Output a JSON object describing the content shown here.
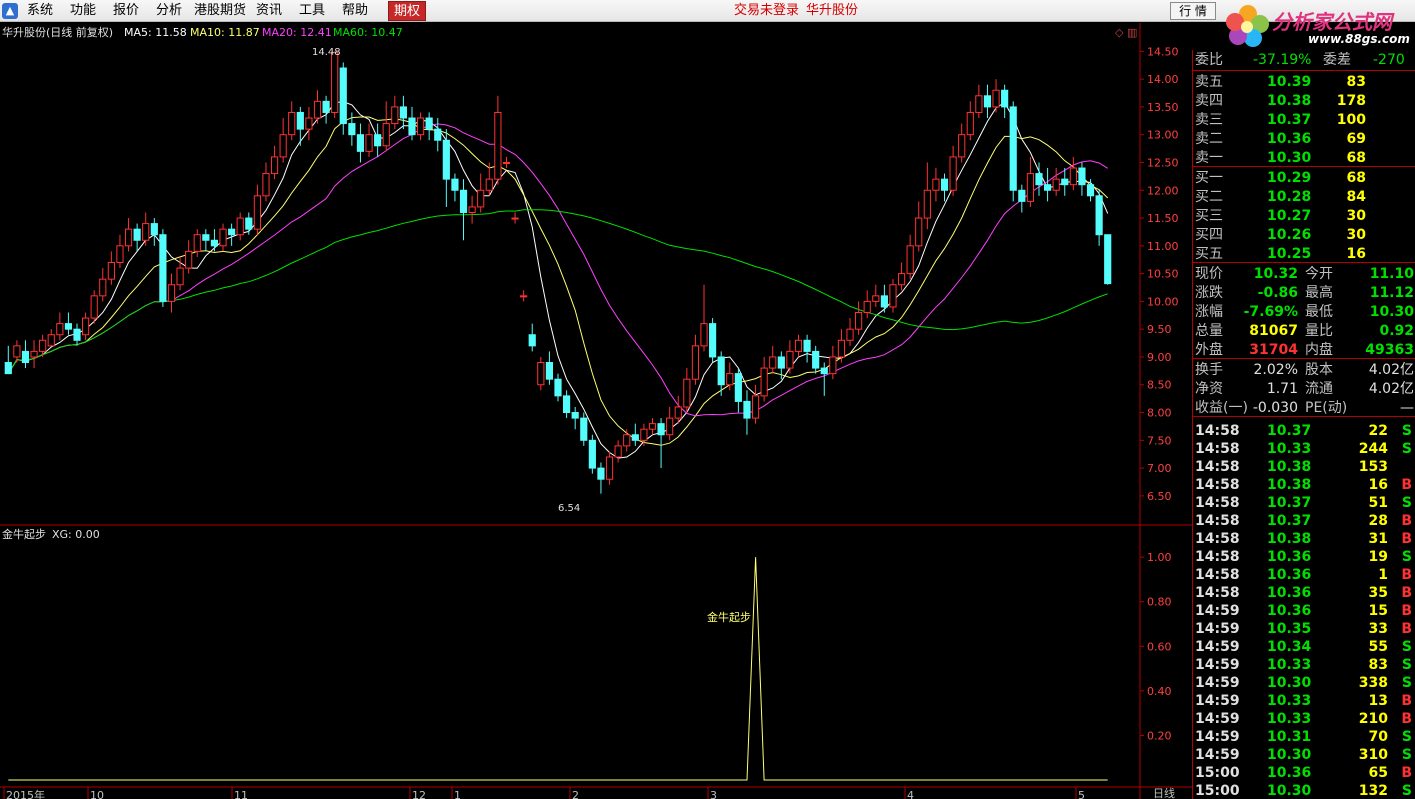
{
  "menu": {
    "items": [
      "系统",
      "功能",
      "报价",
      "分析",
      "港股期货",
      "资讯",
      "工具",
      "帮助"
    ],
    "active": "期权",
    "status1": "交易未登录",
    "status2": "华升股份",
    "quote_button": "行 情"
  },
  "brand": {
    "title": "分析家公式网",
    "url": "www.88gs.com"
  },
  "main_chart": {
    "title": "华升股份(日线 前复权)",
    "ma5_label": "MA5: 11.58",
    "ma10_label": "MA10: 11.87",
    "ma20_label": "MA20: 12.41",
    "ma60_label": "MA60: 10.47",
    "high_label": "14.48",
    "low_label": "6.54",
    "y_ticks": [
      "14.50",
      "14.00",
      "13.50",
      "13.00",
      "12.50",
      "12.00",
      "11.50",
      "11.00",
      "10.50",
      "10.00",
      "9.50",
      "9.00",
      "8.50",
      "8.00",
      "7.50",
      "7.00",
      "6.50"
    ],
    "colors": {
      "up": "#ff3232",
      "down": "#54fcfc",
      "ma5": "#ffffff",
      "ma10": "#ffff70",
      "ma20": "#ff40ff",
      "ma60": "#00e000",
      "axis": "#b00000"
    }
  },
  "sub_chart": {
    "title": "金牛起步",
    "xg_label": "XG: 0.00",
    "signal_label": "金牛起步",
    "y_ticks": [
      "1.00",
      "0.80",
      "0.60",
      "0.40",
      "0.20"
    ]
  },
  "x_axis": {
    "labels": [
      "2015年",
      "10",
      "11",
      "12",
      "1",
      "2",
      "3",
      "4",
      "5"
    ],
    "period": "日线"
  },
  "chart_data": {
    "type": "candlestick",
    "title": "华升股份(日线 前复权)",
    "ylim": [
      6.3,
      14.65
    ],
    "high": 14.48,
    "low": 6.54,
    "candles_ohlc": [
      [
        8.9,
        8.7,
        9.2,
        8.7
      ],
      [
        9.0,
        9.2,
        9.3,
        8.9
      ],
      [
        9.1,
        8.9,
        9.3,
        8.8
      ],
      [
        9.0,
        9.1,
        9.3,
        8.8
      ],
      [
        9.1,
        9.3,
        9.4,
        9.0
      ],
      [
        9.2,
        9.4,
        9.5,
        9.2
      ],
      [
        9.4,
        9.6,
        9.8,
        9.3
      ],
      [
        9.6,
        9.5,
        9.8,
        9.4
      ],
      [
        9.5,
        9.3,
        9.6,
        9.2
      ],
      [
        9.4,
        9.7,
        9.8,
        9.3
      ],
      [
        9.7,
        10.1,
        10.2,
        9.6
      ],
      [
        10.1,
        10.4,
        10.6,
        10.0
      ],
      [
        10.4,
        10.7,
        10.9,
        10.3
      ],
      [
        10.7,
        11.0,
        11.2,
        10.6
      ],
      [
        11.0,
        11.3,
        11.5,
        10.9
      ],
      [
        11.3,
        11.1,
        11.4,
        10.9
      ],
      [
        11.1,
        11.4,
        11.6,
        11.0
      ],
      [
        11.4,
        11.2,
        11.5,
        11.0
      ],
      [
        11.2,
        10.0,
        11.3,
        9.9
      ],
      [
        10.0,
        10.3,
        10.5,
        9.8
      ],
      [
        10.3,
        10.6,
        10.8,
        10.2
      ],
      [
        10.6,
        10.9,
        11.1,
        10.5
      ],
      [
        10.9,
        11.2,
        11.3,
        10.8
      ],
      [
        11.2,
        11.1,
        11.3,
        10.9
      ],
      [
        11.1,
        11.0,
        11.3,
        10.9
      ],
      [
        11.0,
        11.3,
        11.4,
        10.9
      ],
      [
        11.3,
        11.2,
        11.4,
        11.0
      ],
      [
        11.2,
        11.5,
        11.6,
        11.1
      ],
      [
        11.5,
        11.3,
        11.6,
        11.2
      ],
      [
        11.3,
        11.9,
        12.1,
        11.2
      ],
      [
        11.9,
        12.3,
        12.5,
        11.8
      ],
      [
        12.3,
        12.6,
        12.8,
        12.2
      ],
      [
        12.6,
        13.0,
        13.3,
        12.5
      ],
      [
        13.0,
        13.4,
        13.6,
        12.9
      ],
      [
        13.4,
        13.1,
        13.5,
        12.8
      ],
      [
        13.1,
        13.3,
        13.5,
        12.9
      ],
      [
        13.3,
        13.6,
        13.8,
        13.2
      ],
      [
        13.6,
        13.4,
        13.7,
        13.2
      ],
      [
        13.4,
        14.48,
        14.5,
        13.3
      ],
      [
        14.2,
        13.2,
        14.3,
        13.0
      ],
      [
        13.2,
        13.0,
        13.4,
        12.8
      ],
      [
        13.0,
        12.7,
        13.2,
        12.5
      ],
      [
        12.7,
        13.0,
        13.2,
        12.6
      ],
      [
        13.0,
        12.8,
        13.2,
        12.6
      ],
      [
        12.8,
        13.2,
        13.6,
        12.7
      ],
      [
        13.2,
        13.5,
        13.7,
        13.1
      ],
      [
        13.5,
        13.3,
        13.7,
        13.1
      ],
      [
        13.3,
        13.0,
        13.5,
        12.9
      ],
      [
        13.0,
        13.3,
        13.4,
        12.9
      ],
      [
        13.3,
        13.1,
        13.4,
        12.9
      ],
      [
        13.1,
        12.9,
        13.3,
        12.7
      ],
      [
        12.9,
        12.2,
        13.1,
        11.7
      ],
      [
        12.2,
        12.0,
        12.3,
        11.8
      ],
      [
        12.0,
        11.6,
        12.2,
        11.1
      ],
      [
        11.6,
        11.7,
        11.9,
        11.4
      ],
      [
        11.7,
        12.0,
        12.3,
        11.6
      ],
      [
        12.0,
        12.2,
        12.5,
        11.9
      ],
      [
        12.2,
        13.4,
        13.7,
        12.1
      ],
      [
        12.5,
        12.5,
        12.6,
        12.4
      ],
      [
        11.5,
        11.5,
        11.6,
        11.4
      ],
      [
        10.1,
        10.1,
        10.2,
        10.0
      ],
      [
        9.4,
        9.2,
        9.6,
        9.1
      ],
      [
        8.5,
        8.9,
        9.0,
        8.4
      ],
      [
        8.9,
        8.6,
        9.1,
        8.5
      ],
      [
        8.6,
        8.3,
        8.7,
        8.2
      ],
      [
        8.3,
        8.0,
        8.4,
        7.9
      ],
      [
        8.0,
        7.9,
        8.1,
        7.7
      ],
      [
        7.9,
        7.5,
        8.0,
        7.4
      ],
      [
        7.5,
        7.0,
        7.6,
        6.9
      ],
      [
        7.0,
        6.8,
        7.1,
        6.54
      ],
      [
        6.8,
        7.2,
        7.3,
        6.7
      ],
      [
        7.2,
        7.4,
        7.5,
        7.1
      ],
      [
        7.4,
        7.6,
        7.7,
        7.3
      ],
      [
        7.6,
        7.5,
        7.8,
        7.4
      ],
      [
        7.5,
        7.7,
        7.8,
        7.4
      ],
      [
        7.7,
        7.8,
        7.9,
        7.6
      ],
      [
        7.8,
        7.6,
        7.9,
        7.0
      ],
      [
        7.6,
        7.9,
        8.1,
        7.5
      ],
      [
        7.9,
        8.1,
        8.3,
        7.8
      ],
      [
        8.1,
        8.6,
        8.8,
        8.0
      ],
      [
        8.6,
        9.2,
        9.4,
        8.5
      ],
      [
        9.2,
        9.6,
        10.3,
        9.1
      ],
      [
        9.6,
        9.0,
        9.7,
        8.9
      ],
      [
        9.0,
        8.5,
        9.1,
        8.3
      ],
      [
        8.5,
        8.7,
        8.9,
        8.4
      ],
      [
        8.7,
        8.2,
        8.8,
        8.0
      ],
      [
        8.2,
        7.9,
        8.4,
        7.6
      ],
      [
        7.9,
        8.3,
        8.5,
        7.8
      ],
      [
        8.3,
        8.8,
        9.0,
        8.2
      ],
      [
        8.8,
        9.0,
        9.2,
        8.7
      ],
      [
        9.0,
        8.8,
        9.1,
        8.6
      ],
      [
        8.8,
        9.1,
        9.3,
        8.7
      ],
      [
        9.1,
        9.3,
        9.4,
        9.0
      ],
      [
        9.3,
        9.1,
        9.4,
        8.9
      ],
      [
        9.1,
        8.8,
        9.2,
        8.7
      ],
      [
        8.8,
        8.7,
        8.9,
        8.3
      ],
      [
        8.7,
        9.0,
        9.2,
        8.6
      ],
      [
        9.0,
        9.3,
        9.5,
        8.9
      ],
      [
        9.3,
        9.5,
        9.7,
        9.2
      ],
      [
        9.5,
        9.8,
        10.0,
        9.4
      ],
      [
        9.8,
        10.0,
        10.2,
        9.7
      ],
      [
        10.0,
        10.1,
        10.3,
        9.9
      ],
      [
        10.1,
        9.9,
        10.3,
        9.8
      ],
      [
        9.9,
        10.3,
        10.4,
        9.8
      ],
      [
        10.3,
        10.5,
        10.7,
        10.2
      ],
      [
        10.5,
        11.0,
        11.2,
        10.4
      ],
      [
        11.0,
        11.5,
        11.8,
        10.9
      ],
      [
        11.5,
        12.0,
        12.5,
        11.3
      ],
      [
        12.0,
        12.2,
        12.4,
        11.8
      ],
      [
        12.2,
        12.0,
        12.3,
        11.8
      ],
      [
        12.0,
        12.6,
        12.8,
        11.9
      ],
      [
        12.6,
        13.0,
        13.2,
        12.5
      ],
      [
        13.0,
        13.4,
        13.6,
        12.9
      ],
      [
        13.4,
        13.7,
        13.9,
        13.3
      ],
      [
        13.7,
        13.5,
        13.9,
        13.3
      ],
      [
        13.5,
        13.8,
        14.0,
        13.4
      ],
      [
        13.8,
        13.5,
        13.9,
        13.3
      ],
      [
        13.5,
        12.0,
        13.6,
        11.8
      ],
      [
        12.0,
        11.8,
        12.1,
        11.6
      ],
      [
        11.8,
        12.3,
        12.6,
        11.7
      ],
      [
        12.3,
        12.1,
        12.5,
        11.9
      ],
      [
        12.1,
        12.0,
        12.4,
        11.8
      ],
      [
        12.0,
        12.2,
        12.4,
        11.9
      ],
      [
        12.2,
        12.1,
        12.4,
        11.9
      ],
      [
        12.1,
        12.4,
        12.6,
        12.0
      ],
      [
        12.4,
        12.1,
        12.5,
        11.9
      ],
      [
        12.1,
        11.9,
        12.2,
        11.8
      ],
      [
        11.9,
        11.2,
        12.0,
        11.0
      ],
      [
        11.2,
        10.32,
        11.12,
        10.3
      ]
    ],
    "signal": {
      "type": "line",
      "name": "金牛起步",
      "peak_value": 1.0,
      "peak_index": 87,
      "ylim": [
        0,
        1.05
      ]
    }
  },
  "panel": {
    "committee": {
      "label1": "委比",
      "value1": "-37.19%",
      "label2": "委差",
      "value2": "-270"
    },
    "sell": [
      {
        "label": "卖五",
        "price": "10.39",
        "vol": "83"
      },
      {
        "label": "卖四",
        "price": "10.38",
        "vol": "178"
      },
      {
        "label": "卖三",
        "price": "10.37",
        "vol": "100"
      },
      {
        "label": "卖二",
        "price": "10.36",
        "vol": "69"
      },
      {
        "label": "卖一",
        "price": "10.30",
        "vol": "68"
      }
    ],
    "buy": [
      {
        "label": "买一",
        "price": "10.29",
        "vol": "68"
      },
      {
        "label": "买二",
        "price": "10.28",
        "vol": "84"
      },
      {
        "label": "买三",
        "price": "10.27",
        "vol": "30"
      },
      {
        "label": "买四",
        "price": "10.26",
        "vol": "30"
      },
      {
        "label": "买五",
        "price": "10.25",
        "vol": "16"
      }
    ],
    "stats": [
      {
        "l1": "现价",
        "v1": "10.32",
        "c1": "#00e000",
        "l2": "今开",
        "v2": "11.10",
        "c2": "#00e000"
      },
      {
        "l1": "涨跌",
        "v1": "-0.86",
        "c1": "#00e000",
        "l2": "最高",
        "v2": "11.12",
        "c2": "#00e000"
      },
      {
        "l1": "涨幅",
        "v1": "-7.69%",
        "c1": "#00e000",
        "l2": "最低",
        "v2": "10.30",
        "c2": "#00e000"
      },
      {
        "l1": "总量",
        "v1": "81067",
        "c1": "#ffff00",
        "l2": "量比",
        "v2": "0.92",
        "c2": "#00e000"
      },
      {
        "l1": "外盘",
        "v1": "31704",
        "c1": "#ff3232",
        "l2": "内盘",
        "v2": "49363",
        "c2": "#00e000"
      }
    ],
    "stats2": [
      {
        "l1": "换手",
        "v1": "2.02%",
        "l2": "股本",
        "v2": "4.02亿"
      },
      {
        "l1": "净资",
        "v1": "1.71",
        "l2": "流通",
        "v2": "4.02亿"
      },
      {
        "l1": "收益(一)",
        "v1": "-0.030",
        "l2": "PE(动)",
        "v2": "—"
      }
    ],
    "ticks": [
      {
        "time": "14:58",
        "price": "10.37",
        "vol": "22",
        "side": "S"
      },
      {
        "time": "14:58",
        "price": "10.33",
        "vol": "244",
        "side": "S"
      },
      {
        "time": "14:58",
        "price": "10.38",
        "vol": "153",
        "side": ""
      },
      {
        "time": "14:58",
        "price": "10.38",
        "vol": "16",
        "side": "B"
      },
      {
        "time": "14:58",
        "price": "10.37",
        "vol": "51",
        "side": "S"
      },
      {
        "time": "14:58",
        "price": "10.37",
        "vol": "28",
        "side": "B"
      },
      {
        "time": "14:58",
        "price": "10.38",
        "vol": "31",
        "side": "B"
      },
      {
        "time": "14:58",
        "price": "10.36",
        "vol": "19",
        "side": "S"
      },
      {
        "time": "14:58",
        "price": "10.36",
        "vol": "1",
        "side": "B"
      },
      {
        "time": "14:58",
        "price": "10.36",
        "vol": "35",
        "side": "B"
      },
      {
        "time": "14:59",
        "price": "10.36",
        "vol": "15",
        "side": "B"
      },
      {
        "time": "14:59",
        "price": "10.35",
        "vol": "33",
        "side": "B"
      },
      {
        "time": "14:59",
        "price": "10.34",
        "vol": "55",
        "side": "S"
      },
      {
        "time": "14:59",
        "price": "10.33",
        "vol": "83",
        "side": "S"
      },
      {
        "time": "14:59",
        "price": "10.30",
        "vol": "338",
        "side": "S"
      },
      {
        "time": "14:59",
        "price": "10.33",
        "vol": "13",
        "side": "B"
      },
      {
        "time": "14:59",
        "price": "10.33",
        "vol": "210",
        "side": "B"
      },
      {
        "time": "14:59",
        "price": "10.31",
        "vol": "70",
        "side": "S"
      },
      {
        "time": "14:59",
        "price": "10.30",
        "vol": "310",
        "side": "S"
      },
      {
        "time": "15:00",
        "price": "10.36",
        "vol": "65",
        "side": "B"
      },
      {
        "time": "15:00",
        "price": "10.30",
        "vol": "132",
        "side": "S"
      }
    ]
  }
}
